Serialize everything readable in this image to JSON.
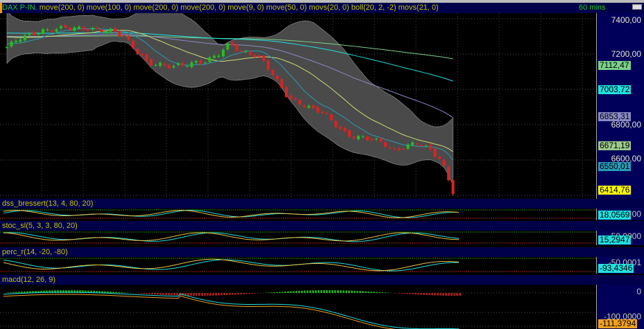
{
  "header": {
    "symbol": "DAX P-IN.",
    "studies": "move(200, 0) move(100, 0) move(200, 0) move(200, 0) move(9, 0) move(50, 0) movs(20, 0) boll(20, 2, -2) movs(21, 0)",
    "timeframe": "60 mins"
  },
  "price_axis": {
    "ticks": [
      "7400,00",
      "7200,00",
      "6800,00",
      "6600,00"
    ],
    "tags": [
      {
        "v": "7112,47",
        "c": "#7ad08a"
      },
      {
        "v": "7003,72",
        "c": "#20e0e0"
      },
      {
        "v": "6853,31",
        "c": "#8a8ac8"
      },
      {
        "v": "6671,19",
        "c": "#9ac88a"
      },
      {
        "v": "6550,01",
        "c": "#2a9ab8"
      },
      {
        "v": "6414,76",
        "c": "#ffff00"
      }
    ]
  },
  "panels": [
    {
      "title": "dss_bressert(13, 4, 80, 20)",
      "value": "18,0569",
      "ghost": "00"
    },
    {
      "title": "stoc_sl(5, 3, 3, 80, 20)",
      "value": "15,2947",
      "ghost": "50,0000"
    },
    {
      "title": "perc_r(14, -20, -80)",
      "value": "-93,4346",
      "ghost": "-50,0001"
    },
    {
      "title": "macd(12, 26, 9)",
      "value": "-111,3794",
      "zero": "0",
      "ghost": "-100,0000"
    }
  ],
  "chart_data": {
    "type": "candlestick",
    "ylim": [
      6400,
      7450
    ],
    "anchors": [
      7240,
      7290,
      7310,
      7330,
      7340,
      7350,
      7345,
      7340,
      7335,
      7330,
      7300,
      7220,
      7150,
      7140,
      7130,
      7140,
      7150,
      7160,
      7200,
      7260,
      7210,
      7200,
      7150,
      7050,
      6950,
      6920,
      6890,
      6870,
      6800,
      6740,
      6730,
      6720,
      6700,
      6650,
      6680,
      6700,
      6660,
      6600,
      6420
    ]
  }
}
